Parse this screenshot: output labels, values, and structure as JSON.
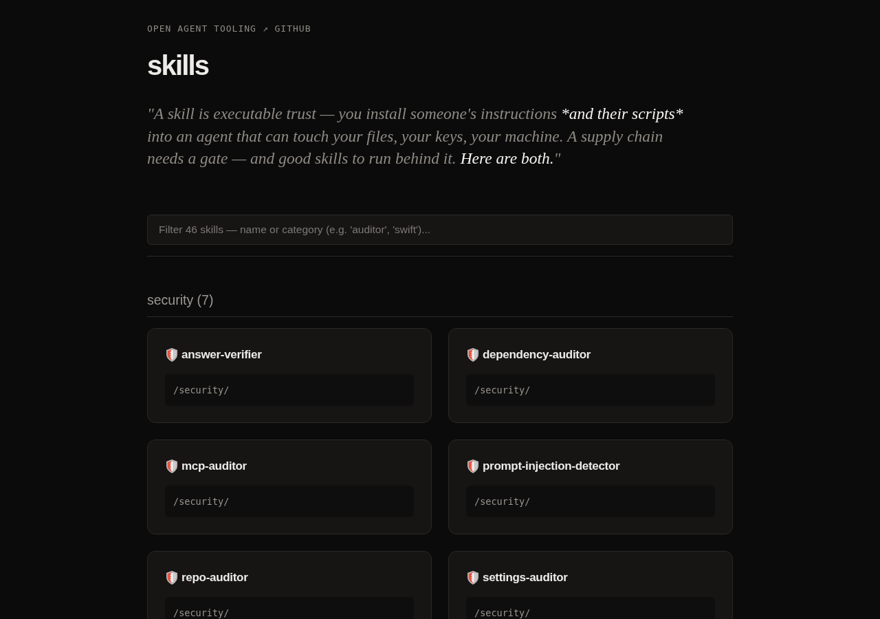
{
  "header": {
    "eyebrow": "OPEN AGENT TOOLING",
    "link": "↗ GITHUB"
  },
  "title": "skills",
  "quote": [
    {
      "text": "\"A skill is executable trust — you install someone's instructions ",
      "emphasis": false
    },
    {
      "text": "*and their scripts*",
      "emphasis": true
    },
    {
      "text": " into an agent that can touch your files, your keys, your machine. A supply chain needs a gate — and good skills to run behind it. ",
      "emphasis": false
    },
    {
      "text": "Here are both.",
      "emphasis": true
    },
    {
      "text": "\"",
      "emphasis": false
    }
  ],
  "search": {
    "placeholder": "Filter 46 skills — name or category (e.g. 'auditor', 'swift')..."
  },
  "sections": [
    {
      "heading": "security (7)",
      "skills": [
        {
          "name": "answer-verifier",
          "path": "/security/"
        },
        {
          "name": "dependency-auditor",
          "path": "/security/"
        },
        {
          "name": "mcp-auditor",
          "path": "/security/"
        },
        {
          "name": "prompt-injection-detector",
          "path": "/security/"
        },
        {
          "name": "repo-auditor",
          "path": "/security/"
        },
        {
          "name": "settings-auditor",
          "path": "/security/"
        }
      ]
    }
  ]
}
